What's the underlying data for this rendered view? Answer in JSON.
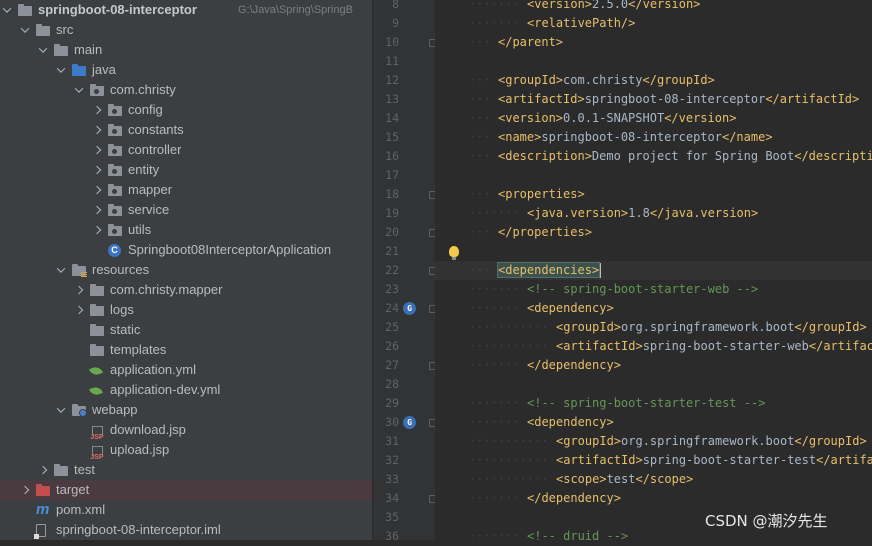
{
  "project": {
    "root_name": "springboot-08-interceptor",
    "root_path": "G:\\Java\\Spring\\SpringB",
    "items": [
      {
        "label": "src",
        "icon": "folder-icon",
        "expanded": true
      },
      {
        "label": "main",
        "icon": "folder-icon",
        "expanded": true
      },
      {
        "label": "java",
        "icon": "source-folder-icon",
        "expanded": true
      },
      {
        "label": "com.christy",
        "icon": "package-icon",
        "expanded": true
      },
      {
        "label": "config",
        "icon": "package-icon",
        "expanded": false
      },
      {
        "label": "constants",
        "icon": "package-icon",
        "expanded": false
      },
      {
        "label": "controller",
        "icon": "package-icon",
        "expanded": false
      },
      {
        "label": "entity",
        "icon": "package-icon",
        "expanded": false
      },
      {
        "label": "mapper",
        "icon": "package-icon",
        "expanded": false
      },
      {
        "label": "service",
        "icon": "package-icon",
        "expanded": false
      },
      {
        "label": "utils",
        "icon": "package-icon",
        "expanded": false
      },
      {
        "label": "Springboot08InterceptorApplication",
        "icon": "spring-class-icon"
      },
      {
        "label": "resources",
        "icon": "resources-folder-icon",
        "expanded": true
      },
      {
        "label": "com.christy.mapper",
        "icon": "folder-icon",
        "expanded": false
      },
      {
        "label": "logs",
        "icon": "folder-icon",
        "expanded": false
      },
      {
        "label": "static",
        "icon": "folder-icon"
      },
      {
        "label": "templates",
        "icon": "folder-icon"
      },
      {
        "label": "application.yml",
        "icon": "spring-yml-icon"
      },
      {
        "label": "application-dev.yml",
        "icon": "spring-yml-icon"
      },
      {
        "label": "webapp",
        "icon": "web-folder-icon",
        "expanded": true
      },
      {
        "label": "download.jsp",
        "icon": "jsp-icon"
      },
      {
        "label": "upload.jsp",
        "icon": "jsp-icon"
      },
      {
        "label": "test",
        "icon": "folder-icon",
        "expanded": false
      },
      {
        "label": "target",
        "icon": "excluded-folder-icon",
        "expanded": false
      },
      {
        "label": "pom.xml",
        "icon": "maven-icon"
      },
      {
        "label": "springboot-08-interceptor.iml",
        "icon": "module-file-icon"
      }
    ]
  },
  "editor": {
    "lines": [
      {
        "n": "8",
        "tokens": [
          {
            "t": "<version>",
            "c": "tag"
          },
          {
            "t": "2.5.0",
            "c": "txt"
          },
          {
            "t": "</version>",
            "c": "tag"
          }
        ],
        "indent": 2
      },
      {
        "n": "9",
        "tokens": [
          {
            "t": "<relativePath/>",
            "c": "tag"
          }
        ],
        "indent": 2
      },
      {
        "n": "10",
        "tokens": [
          {
            "t": "</parent>",
            "c": "tag"
          }
        ],
        "indent": 1
      },
      {
        "n": "11",
        "tokens": [],
        "indent": 0
      },
      {
        "n": "12",
        "tokens": [
          {
            "t": "<groupId>",
            "c": "tag"
          },
          {
            "t": "com.christy",
            "c": "txt"
          },
          {
            "t": "</groupId>",
            "c": "tag"
          }
        ],
        "indent": 1
      },
      {
        "n": "13",
        "tokens": [
          {
            "t": "<artifactId>",
            "c": "tag"
          },
          {
            "t": "springboot-08-interceptor",
            "c": "txt"
          },
          {
            "t": "</artifactId>",
            "c": "tag"
          }
        ],
        "indent": 1
      },
      {
        "n": "14",
        "tokens": [
          {
            "t": "<version>",
            "c": "tag"
          },
          {
            "t": "0.0.1-SNAPSHOT",
            "c": "txt"
          },
          {
            "t": "</version>",
            "c": "tag"
          }
        ],
        "indent": 1
      },
      {
        "n": "15",
        "tokens": [
          {
            "t": "<name>",
            "c": "tag"
          },
          {
            "t": "springboot-08-interceptor",
            "c": "txt"
          },
          {
            "t": "</name>",
            "c": "tag"
          }
        ],
        "indent": 1
      },
      {
        "n": "16",
        "tokens": [
          {
            "t": "<description>",
            "c": "tag"
          },
          {
            "t": "Demo project for Spring Boot",
            "c": "txt"
          },
          {
            "t": "</description>",
            "c": "tag"
          }
        ],
        "indent": 1
      },
      {
        "n": "17",
        "tokens": [],
        "indent": 0
      },
      {
        "n": "18",
        "tokens": [
          {
            "t": "<properties>",
            "c": "tag"
          }
        ],
        "indent": 1
      },
      {
        "n": "19",
        "tokens": [
          {
            "t": "<java.version>",
            "c": "tag"
          },
          {
            "t": "1.8",
            "c": "txt"
          },
          {
            "t": "</java.version>",
            "c": "tag"
          }
        ],
        "indent": 2
      },
      {
        "n": "20",
        "tokens": [
          {
            "t": "</properties>",
            "c": "tag"
          }
        ],
        "indent": 1
      },
      {
        "n": "21",
        "tokens": [],
        "indent": 0
      },
      {
        "n": "22",
        "tokens": [
          {
            "t": "<dependencies>",
            "c": "tag hl"
          }
        ],
        "indent": 1
      },
      {
        "n": "23",
        "tokens": [
          {
            "t": "<!-- spring-boot-starter-web -->",
            "c": "cmt"
          }
        ],
        "indent": 2
      },
      {
        "n": "24",
        "tokens": [
          {
            "t": "<dependency>",
            "c": "tag"
          }
        ],
        "indent": 2
      },
      {
        "n": "25",
        "tokens": [
          {
            "t": "<groupId>",
            "c": "tag"
          },
          {
            "t": "org.springframework.boot",
            "c": "txt"
          },
          {
            "t": "</groupId>",
            "c": "tag"
          }
        ],
        "indent": 3
      },
      {
        "n": "26",
        "tokens": [
          {
            "t": "<artifactId>",
            "c": "tag"
          },
          {
            "t": "spring-boot-starter-web",
            "c": "txt"
          },
          {
            "t": "</artifactId>",
            "c": "tag"
          }
        ],
        "indent": 3
      },
      {
        "n": "27",
        "tokens": [
          {
            "t": "</dependency>",
            "c": "tag"
          }
        ],
        "indent": 2
      },
      {
        "n": "28",
        "tokens": [],
        "indent": 0
      },
      {
        "n": "29",
        "tokens": [
          {
            "t": "<!-- spring-boot-starter-test -->",
            "c": "cmt"
          }
        ],
        "indent": 2
      },
      {
        "n": "30",
        "tokens": [
          {
            "t": "<dependency>",
            "c": "tag"
          }
        ],
        "indent": 2
      },
      {
        "n": "31",
        "tokens": [
          {
            "t": "<groupId>",
            "c": "tag"
          },
          {
            "t": "org.springframework.boot",
            "c": "txt"
          },
          {
            "t": "</groupId>",
            "c": "tag"
          }
        ],
        "indent": 3
      },
      {
        "n": "32",
        "tokens": [
          {
            "t": "<artifactId>",
            "c": "tag"
          },
          {
            "t": "spring-boot-starter-test",
            "c": "txt"
          },
          {
            "t": "</artifactId>",
            "c": "tag"
          }
        ],
        "indent": 3
      },
      {
        "n": "33",
        "tokens": [
          {
            "t": "<scope>",
            "c": "tag"
          },
          {
            "t": "test",
            "c": "txt"
          },
          {
            "t": "</scope>",
            "c": "tag"
          }
        ],
        "indent": 3
      },
      {
        "n": "34",
        "tokens": [
          {
            "t": "</dependency>",
            "c": "tag"
          }
        ],
        "indent": 2
      },
      {
        "n": "35",
        "tokens": [],
        "indent": 0
      },
      {
        "n": "36",
        "tokens": [
          {
            "t": "<!-- druid -->",
            "c": "cmt"
          }
        ],
        "indent": 2
      }
    ]
  },
  "watermark": "CSDN @潮汐先生"
}
